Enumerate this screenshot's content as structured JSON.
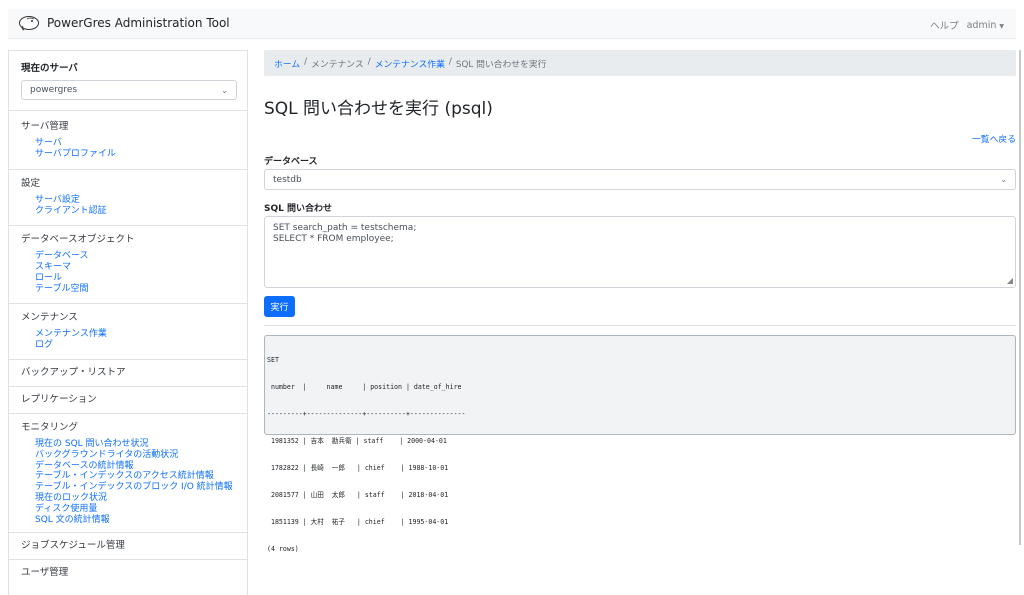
{
  "app": {
    "title": "PowerGres Administration Tool",
    "help_label": "ヘルプ",
    "user_label": "admin"
  },
  "sidebar": {
    "current_server_title": "現在のサーバ",
    "current_server_value": "powergres",
    "sections": [
      {
        "header": "サーバ管理",
        "links": [
          "サーバ",
          "サーバプロファイル"
        ]
      },
      {
        "header": "設定",
        "links": [
          "サーバ設定",
          "クライアント認証"
        ]
      },
      {
        "header": "データベースオブジェクト",
        "links": [
          "データベース",
          "スキーマ",
          "ロール",
          "テーブル空間"
        ]
      },
      {
        "header": "メンテナンス",
        "links": [
          "メンテナンス作業",
          "ログ"
        ]
      },
      {
        "header": "バックアップ・リストア",
        "links": []
      },
      {
        "header": "レプリケーション",
        "links": []
      },
      {
        "header": "モニタリング",
        "links": [
          "現在の SQL 問い合わせ状況",
          "バックグラウンドライタの活動状況",
          "データベースの統計情報",
          "テーブル・インデックスのアクセス統計情報",
          "テーブル・インデックスのブロック I/O 統計情報",
          "現在のロック状況",
          "ディスク使用量",
          "SQL 文の統計情報"
        ]
      },
      {
        "header": "ジョブスケジュール管理",
        "links": []
      },
      {
        "header": "ユーザ管理",
        "links": []
      }
    ]
  },
  "breadcrumb": {
    "items": [
      "ホーム",
      "メンテナンス",
      "メンテナンス作業",
      "SQL 問い合わせを実行"
    ],
    "separator": "/"
  },
  "main": {
    "page_title": "SQL 問い合わせを実行 (psql)",
    "back_link": "一覧へ戻る",
    "database_label": "データベース",
    "database_value": "testdb",
    "query_label": "SQL 問い合わせ",
    "query_lines": [
      "SET search_path = testschema;",
      "SELECT * FROM employee;"
    ],
    "run_button": "実行"
  },
  "result": {
    "lines": [
      "SET",
      " number  |     name     | position | date_of_hire",
      "---------+--------------+----------+--------------",
      " 1981352 | 吉本  勘兵衛 | staff    | 2000-04-01",
      " 1782822 | 長崎  一郎   | chief    | 1988-10-01",
      " 2081577 | 山田  太郎   | staff    | 2018-04-01",
      " 1851139 | 大村  祐子   | chief    | 1995-04-01",
      "(4 rows)"
    ]
  },
  "colors": {
    "link": "#0d6efd",
    "button_bg": "#0d6efd",
    "breadcrumb_bg": "#e9ecef",
    "result_bg": "#f1f3f5"
  },
  "icons": {
    "logo": "elephant-logo-icon",
    "dropdown": "chevron-down-icon",
    "resize": "resize-handle-icon"
  }
}
